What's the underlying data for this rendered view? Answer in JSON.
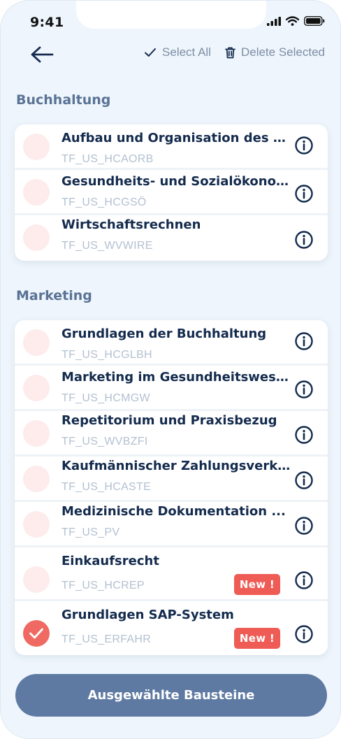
{
  "status_bar": {
    "time": "9:41"
  },
  "toolbar": {
    "select_all_label": "Select All",
    "delete_selected_label": "Delete Selected"
  },
  "sections": [
    {
      "title": "Buchhaltung",
      "items": [
        {
          "title": "Aufbau und Organisation des Betr...",
          "code": "TF_US_HCAORB",
          "checked": false,
          "new_badge": ""
        },
        {
          "title": "Gesundheits- und Sozialökonomie",
          "code": "TF_US_HCGSÖ",
          "checked": false,
          "new_badge": ""
        },
        {
          "title": "Wirtschaftsrechnen",
          "code": "TF_US_WVWIRE",
          "checked": false,
          "new_badge": ""
        }
      ]
    },
    {
      "title": "Marketing",
      "items": [
        {
          "title": "Grundlagen der Buchhaltung",
          "code": "TF_US_HCGLBH",
          "checked": false,
          "new_badge": ""
        },
        {
          "title": "Marketing im Gesundheitswesen",
          "code": "TF_US_HCMGW",
          "checked": false,
          "new_badge": ""
        },
        {
          "title": "Repetitorium und Praxisbezug",
          "code": "TF_US_WVBZFI",
          "checked": false,
          "new_badge": ""
        },
        {
          "title": "Kaufmännischer Zahlungsverk...",
          "code": "TF_US_HCASTE",
          "checked": false,
          "new_badge": ""
        },
        {
          "title": "Medizinische Dokumentation ...",
          "code": "TF_US_PV",
          "checked": false,
          "new_badge": ""
        },
        {
          "title": "Einkaufsrecht",
          "code": "TF_US_HCREP",
          "checked": false,
          "new_badge": "New !"
        },
        {
          "title": "Grundlagen SAP-System",
          "code": "TF_US_ERFAHR",
          "checked": true,
          "new_badge": "New !"
        }
      ]
    }
  ],
  "footer": {
    "cta_label": "Ausgewählte Bausteine"
  },
  "colors": {
    "background": "#eef5fc",
    "heading": "#142b4e",
    "section": "#5a7395",
    "radio_unchecked": "#fdeceb",
    "radio_checked": "#ef6a62",
    "badge": "#ef5b55",
    "cta": "#5f7aa2"
  },
  "icons": {
    "back": "arrow-left-icon",
    "select_all": "checkmark-icon",
    "delete": "trash-icon",
    "info": "info-icon",
    "check": "check-icon"
  }
}
